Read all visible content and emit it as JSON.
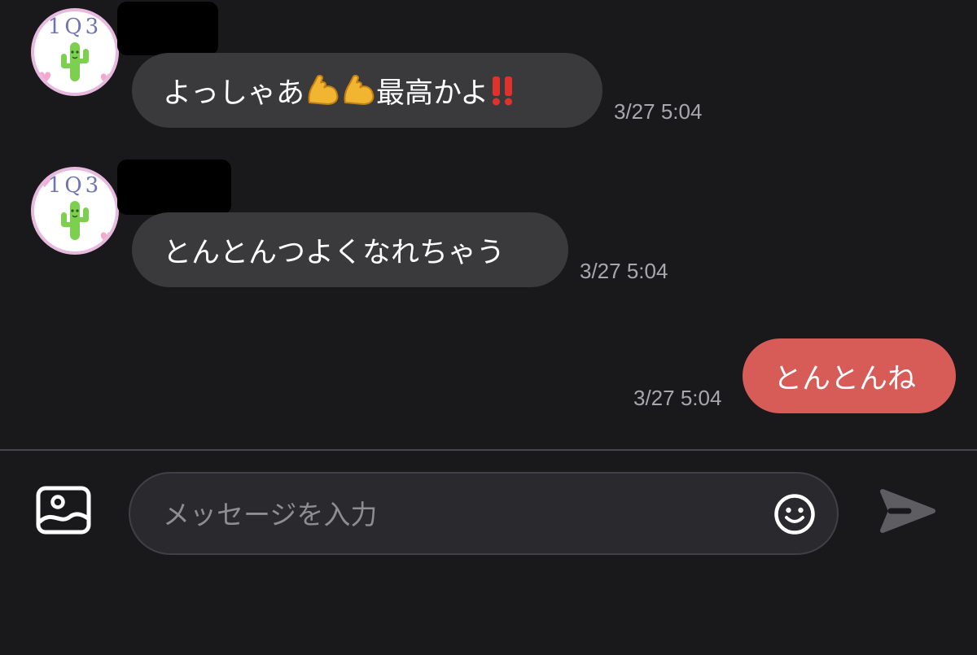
{
  "messages": [
    {
      "sender": "other",
      "avatar_text": "1Q3",
      "text_before": "よっしゃあ",
      "emoji_1": "flexed-biceps-icon",
      "emoji_2": "flexed-biceps-icon",
      "text_after": "最高かよ",
      "emoji_3": "double-exclamation-icon",
      "time": "3/27 5:04"
    },
    {
      "sender": "other",
      "avatar_text": "1Q3",
      "text": "とんとんつよくなれちゃう",
      "time": "3/27 5:04"
    },
    {
      "sender": "me",
      "text": "とんとんね",
      "time": "3/27 5:04"
    }
  ],
  "composer": {
    "placeholder": "メッセージを入力",
    "value": "",
    "image_icon": "image-icon",
    "emoji_icon": "smiley-icon",
    "send_icon": "send-icon"
  },
  "colors": {
    "background": "#19181b",
    "other_bubble": "#3a3a3d",
    "my_bubble": "#d75b57",
    "timestamp": "#a8a8ac"
  }
}
